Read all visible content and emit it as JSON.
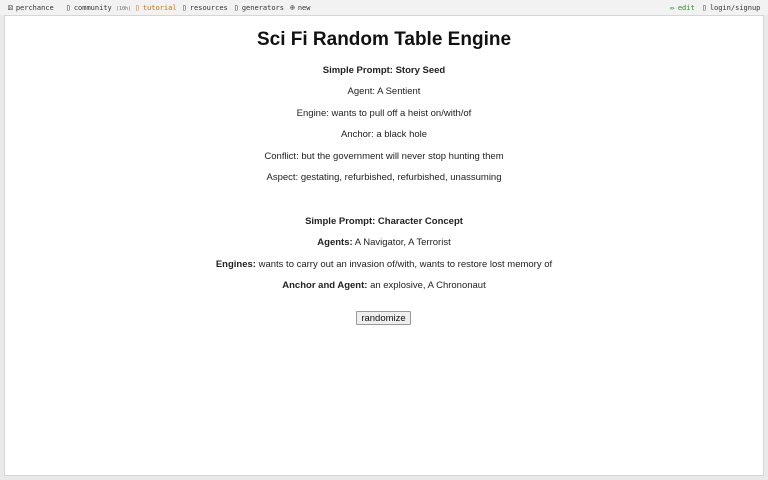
{
  "nav": {
    "brand": "perchance",
    "community": "community",
    "community_count": "(10h)",
    "tutorial": "tutorial",
    "resources": "resources",
    "generators": "generators",
    "new": "new",
    "edit": "edit",
    "login": "login/signup"
  },
  "icons": {
    "brand": "dice-icon",
    "community": "chat-icon",
    "tutorial": "book-icon",
    "resources": "link-icon",
    "generators": "list-icon",
    "new": "plus-circle-icon",
    "edit": "pencil-icon",
    "login": "user-icon"
  },
  "page": {
    "title": "Sci Fi Random Table Engine",
    "section1": {
      "heading": "Simple Prompt: Story Seed",
      "agent": "Agent: A Sentient",
      "engine": "Engine: wants to pull off a heist on/with/of",
      "anchor": "Anchor: a black hole",
      "conflict": "Conflict: but the government will never stop hunting them",
      "aspect": "Aspect: gestating, refurbished, refurbished, unassuming"
    },
    "section2": {
      "heading": "Simple Prompt: Character Concept",
      "agents_label": "Agents:",
      "agents_value": "A Navigator, A Terrorist",
      "engines_label": "Engines:",
      "engines_value": "wants to carry out an invasion of/with, wants to restore lost memory of",
      "anchor_agent_label": "Anchor and Agent:",
      "anchor_agent_value": "an explosive, A Chrononaut"
    },
    "button": "randomize"
  },
  "colors": {
    "tutorial": "#d36d00",
    "edit": "#2e8b2e",
    "background": "#e9e9e9",
    "panel": "#ffffff"
  }
}
